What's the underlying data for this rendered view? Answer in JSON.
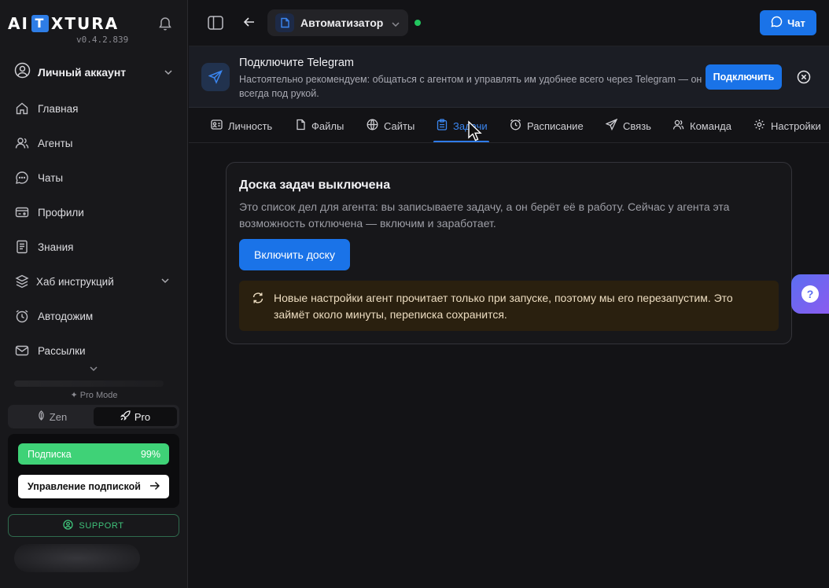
{
  "sidebar": {
    "logo": {
      "left": "AI",
      "box": "T",
      "right": "XTURA"
    },
    "version": "v0.4.2.839",
    "account_label": "Личный аккаунт",
    "items": [
      {
        "label": "Главная",
        "icon": "home-icon"
      },
      {
        "label": "Агенты",
        "icon": "users-icon"
      },
      {
        "label": "Чаты",
        "icon": "chat-bubble-icon"
      },
      {
        "label": "Профили",
        "icon": "id-card-icon"
      },
      {
        "label": "Знания",
        "icon": "book-icon"
      },
      {
        "label": "Хаб инструкций",
        "icon": "hub-icon"
      },
      {
        "label": "Автодожим",
        "icon": "alarm-clock-icon"
      },
      {
        "label": "Рассылки",
        "icon": "mail-icon"
      }
    ],
    "pro_mode_label": "Pro Mode",
    "mode_zen": "Zen",
    "mode_pro": "Pro",
    "subscription_label": "Подписка",
    "subscription_percent": "99%",
    "subscription_fraction": 0.99,
    "manage_subscription": "Управление подпиской",
    "support_label": "SUPPORT"
  },
  "topbar": {
    "agent_name": "Автоматизатор",
    "chat_label": "Чат"
  },
  "banner": {
    "title": "Подключите Telegram",
    "text": "Настоятельно рекомендуем: общаться с агентом и управлять им удобнее всего через Telegram — он всегда под рукой.",
    "connect_label": "Подключить"
  },
  "tabs": [
    {
      "label": "Личность",
      "icon": "persona-icon"
    },
    {
      "label": "Файлы",
      "icon": "file-icon"
    },
    {
      "label": "Сайты",
      "icon": "globe-icon"
    },
    {
      "label": "Задачи",
      "icon": "clipboard-icon",
      "active": true
    },
    {
      "label": "Расписание",
      "icon": "clock-icon"
    },
    {
      "label": "Связь",
      "icon": "send-icon"
    },
    {
      "label": "Команда",
      "icon": "team-icon"
    },
    {
      "label": "Настройки",
      "icon": "gear-icon"
    }
  ],
  "main": {
    "card_title": "Доска задач выключена",
    "card_desc": "Это список дел для агента: вы записываете задачу, а он берёт её в работу. Сейчас у агента эта возможность отключена — включим и заработает.",
    "enable_label": "Включить доску",
    "notice": "Новые настройки агент прочитает только при запуске, поэтому мы его перезапустим. Это займёт около минуты, переписка сохранится."
  },
  "colors": {
    "accent": "#1a73e8",
    "success": "#3fd277",
    "background": "#131316",
    "sidebar": "#18181b",
    "notice_bg": "#2a200f"
  }
}
